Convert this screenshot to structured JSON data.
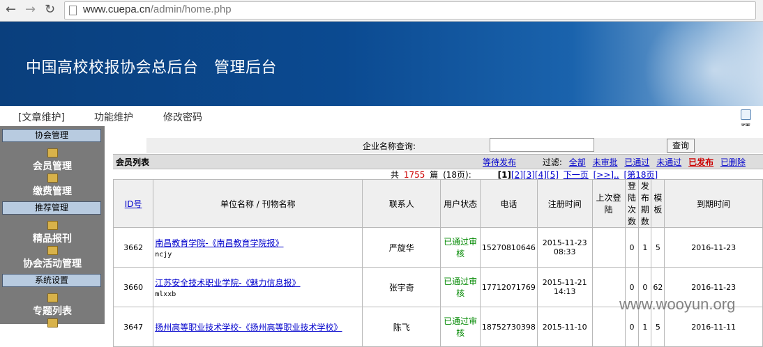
{
  "browser": {
    "url_domain": "www.cuepa.cn",
    "url_path": "/admin/home.php"
  },
  "banner": {
    "title": "中国高校校报协会总后台   管理后台"
  },
  "top_menu": {
    "items": [
      "[文章维护]",
      "功能维护",
      "修改密码"
    ],
    "preview_label": "预"
  },
  "sidebar": {
    "sections": [
      {
        "header": "协会管理",
        "items": [
          "会员管理",
          "缴费管理"
        ]
      },
      {
        "header": "推荐管理",
        "items": [
          "精品报刊",
          "协会活动管理"
        ]
      },
      {
        "header": "系统设置",
        "items": [
          "专题列表"
        ]
      }
    ]
  },
  "search": {
    "label": "企业名称查询:",
    "value": "",
    "button": "查询"
  },
  "list": {
    "title": "会员列表",
    "wait_publish": "等待发布",
    "filter_label": "过滤:",
    "filters": [
      "全部",
      "未审批",
      "已通过",
      "未通过"
    ],
    "filter_published": "已发布",
    "filter_deleted": "已删除"
  },
  "pager": {
    "total_prefix": "共",
    "total": "1755",
    "total_suffix": "篇",
    "pages_info": "(18页):",
    "current": "[1]",
    "pages": [
      "[2]",
      "[3]",
      "[4]",
      "[5]"
    ],
    "next": "下一页",
    "more": "[>>]..",
    "last": "[第18页]"
  },
  "table": {
    "headers": [
      "ID号",
      "单位名称 / 刊物名称",
      "联系人",
      "用户状态",
      "电话",
      "注册时间",
      "上次登陆",
      "登陆次数",
      "发布期数",
      "模板",
      "到期时间"
    ],
    "rows": [
      {
        "id": "3662",
        "name": "南昌教育学院-《南昌教育学院报》",
        "abbr": "ncjy",
        "contact": "严旋华",
        "status": "已通过审核",
        "phone": "15270810646",
        "reg_date": "2015-11-23",
        "reg_time": "08:33",
        "last_login": "",
        "logins": "0",
        "issues": "1",
        "template": "5",
        "expire": "2016-11-23"
      },
      {
        "id": "3660",
        "name": "江苏安全技术职业学院-《魅力信息报》",
        "abbr": "mlxxb",
        "contact": "张宇奇",
        "status": "已通过审核",
        "phone": "17712071769",
        "reg_date": "2015-11-21",
        "reg_time": "14:13",
        "last_login": "",
        "logins": "0",
        "issues": "0",
        "template": "62",
        "expire": "2016-11-23"
      },
      {
        "id": "3647",
        "name": "扬州高等职业技术学校-《扬州高等职业技术学校》",
        "abbr": "",
        "contact": "陈飞",
        "status": "已通过审核",
        "phone": "18752730398",
        "reg_date": "2015-11-10",
        "reg_time": "",
        "last_login": "",
        "logins": "0",
        "issues": "1",
        "template": "5",
        "expire": "2016-11-11"
      }
    ]
  },
  "watermark": "www.wooyun.org"
}
